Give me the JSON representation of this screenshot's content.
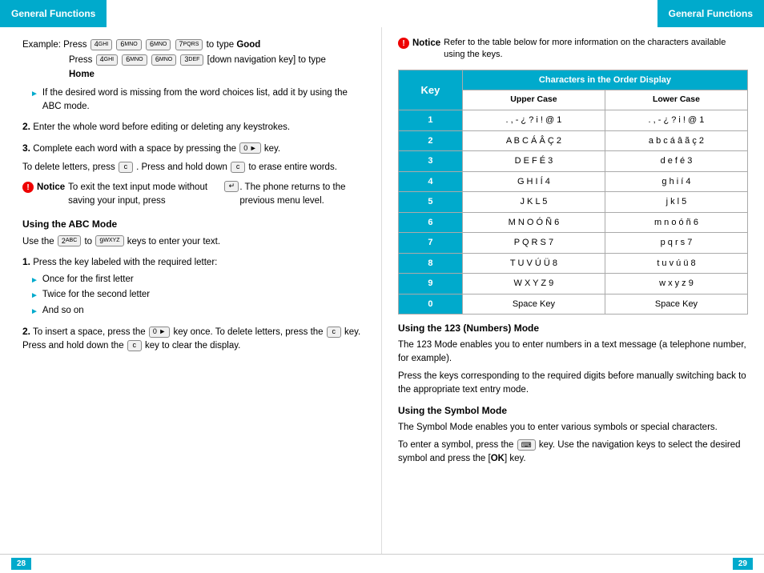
{
  "header": {
    "left_label": "General Functions",
    "right_label": "General Functions"
  },
  "footer": {
    "left_page": "28",
    "right_page": "29"
  },
  "left": {
    "example_label": "Example: Press",
    "example_keys_1": [
      "4",
      "6",
      "6",
      "7"
    ],
    "example_to_type": "to type",
    "example_bold_word": "Good",
    "example_press2": "Press",
    "example_keys_2": [
      "4",
      "6",
      "6",
      "3"
    ],
    "example_nav_key": "[down navigation key] to type",
    "example_bold_word2": "Home",
    "arrow_items": [
      "If the desired word is missing from the word choices list, add it by using the ABC mode."
    ],
    "numbered_items": [
      {
        "num": "2.",
        "text": "Enter the whole word before editing or deleting any keystrokes."
      },
      {
        "num": "3.",
        "text": "Complete each word with a space by pressing the"
      }
    ],
    "key_0_label": "0 ▸",
    "key_c_label": "c",
    "delete_text": "To delete letters, press",
    "delete_text2": ". Press and hold down",
    "delete_text3": "to erase entire words.",
    "notice_icon": "!",
    "notice_label": "Notice",
    "notice_text": "To exit the text input mode without saving your input, press",
    "notice_key": "↩",
    "notice_text2": ". The phone returns to the previous menu level.",
    "section_abc": "Using the ABC Mode",
    "abc_intro": "Use the",
    "abc_key_from": "2",
    "abc_text_mid": "to",
    "abc_key_to": "9",
    "abc_text_end": "keys to enter your text.",
    "abc_step1": "1.",
    "abc_step1_text": "Press the key labeled with the required letter:",
    "abc_bullets": [
      "Once for the first letter",
      "Twice for the second letter",
      "And so on"
    ],
    "abc_step2": "2.",
    "abc_step2_text": "To insert a space, press the",
    "abc_step2_key": "0 ▸",
    "abc_step2_text2": "key once. To delete letters, press the",
    "abc_step2_key2": "c",
    "abc_step2_text3": "key. Press and hold down the",
    "abc_step2_key3": "c",
    "abc_step2_text4": "key to clear the display."
  },
  "right": {
    "notice_icon": "!",
    "notice_label": "Notice",
    "notice_intro": "Refer to the table below for more information on the characters available using the keys.",
    "table_header": "Characters in the Order Display",
    "table_col1": "Key",
    "table_col2": "Upper Case",
    "table_col3": "Lower Case",
    "table_rows": [
      {
        "key": "1",
        "upper": ". , - ¿ ? i ! @ 1",
        "lower": ". , - ¿ ? i ! @ 1"
      },
      {
        "key": "2",
        "upper": "A B C Á Â Ç 2",
        "lower": "a b c á â ã ç 2"
      },
      {
        "key": "3",
        "upper": "D E F É 3",
        "lower": "d e f é 3"
      },
      {
        "key": "4",
        "upper": "G H I Í 4",
        "lower": "g h i í 4"
      },
      {
        "key": "5",
        "upper": "J K L 5",
        "lower": "j k l 5"
      },
      {
        "key": "6",
        "upper": "M N O Ó Ñ 6",
        "lower": "m n o ó ñ 6"
      },
      {
        "key": "7",
        "upper": "P Q R S 7",
        "lower": "p q r s 7"
      },
      {
        "key": "8",
        "upper": "T U V Ú Ü 8",
        "lower": "t u v ú ü 8"
      },
      {
        "key": "9",
        "upper": "W X Y Z 9",
        "lower": "w x y z 9"
      },
      {
        "key": "0",
        "upper": "Space Key",
        "lower": "Space Key"
      }
    ],
    "section_123": "Using the 123 (Numbers) Mode",
    "para_123_1": "The 123 Mode enables you to enter numbers in a text message (a telephone number, for example).",
    "para_123_2": "Press the keys corresponding to the required digits before manually switching back to the appropriate text entry mode.",
    "section_symbol": "Using the Symbol Mode",
    "para_symbol_1": "The Symbol Mode enables you to enter various symbols or special characters.",
    "para_symbol_2_prefix": "To enter a symbol, press the",
    "para_symbol_key": "⊞",
    "para_symbol_2_suffix": "key. Use the navigation keys to select the desired symbol and press the [",
    "para_symbol_ok": "OK",
    "para_symbol_end": "] key."
  }
}
